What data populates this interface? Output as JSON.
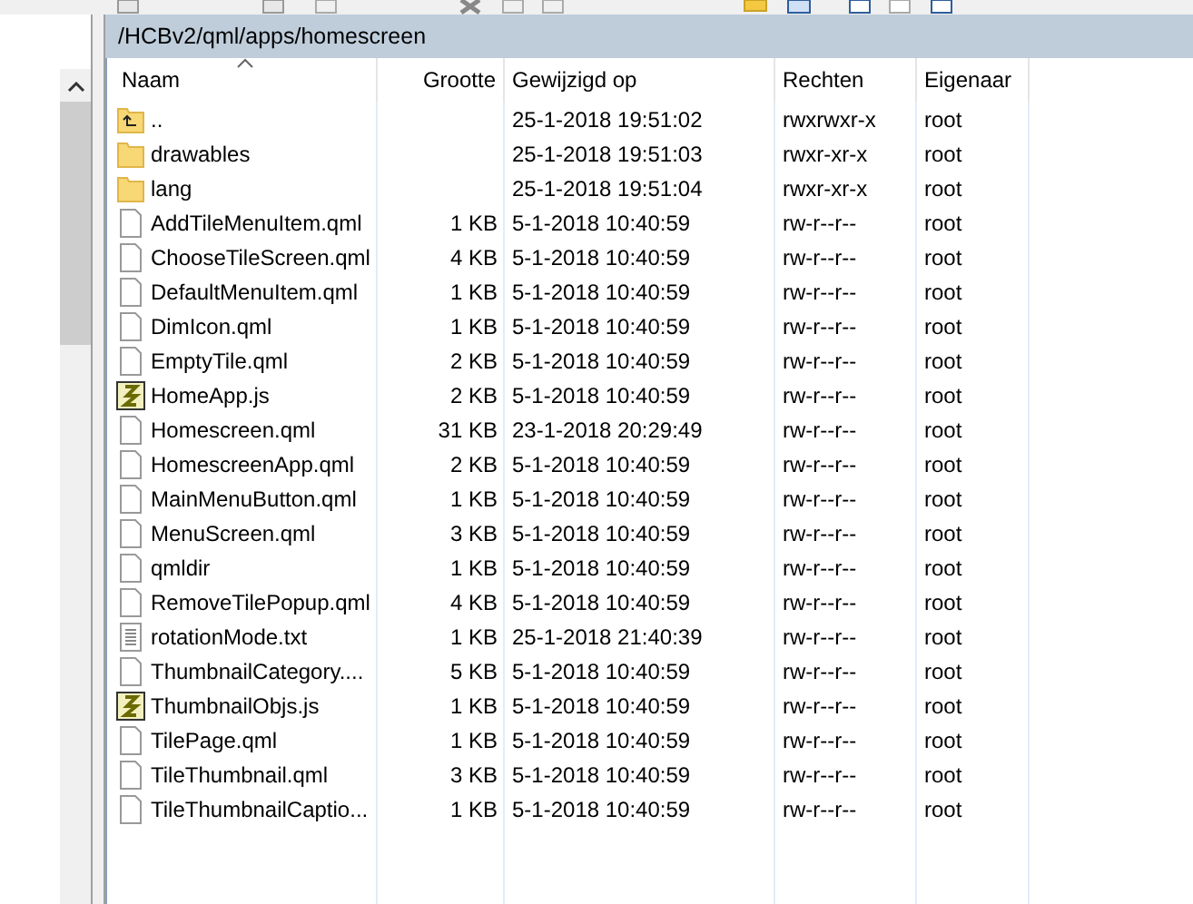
{
  "path_bar": {
    "path": "/HCBv2/qml/apps/homescreen"
  },
  "table": {
    "columns": [
      {
        "label": "Naam",
        "sorted": true
      },
      {
        "label": "Grootte",
        "sorted": false
      },
      {
        "label": "Gewijzigd op",
        "sorted": false
      },
      {
        "label": "Rechten",
        "sorted": false
      },
      {
        "label": "Eigenaar",
        "sorted": false
      }
    ],
    "rows": [
      {
        "kind": "parent",
        "name": "..",
        "size": "",
        "modified": "25-1-2018 19:51:02",
        "rights": "rwxrwxr-x",
        "owner": "root"
      },
      {
        "kind": "folder",
        "name": "drawables",
        "size": "",
        "modified": "25-1-2018 19:51:03",
        "rights": "rwxr-xr-x",
        "owner": "root"
      },
      {
        "kind": "folder",
        "name": "lang",
        "size": "",
        "modified": "25-1-2018 19:51:04",
        "rights": "rwxr-xr-x",
        "owner": "root"
      },
      {
        "kind": "file",
        "name": "AddTileMenuItem.qml",
        "size": "1 KB",
        "modified": "5-1-2018 10:40:59",
        "rights": "rw-r--r--",
        "owner": "root"
      },
      {
        "kind": "file",
        "name": "ChooseTileScreen.qml",
        "size": "4 KB",
        "modified": "5-1-2018 10:40:59",
        "rights": "rw-r--r--",
        "owner": "root"
      },
      {
        "kind": "file",
        "name": "DefaultMenuItem.qml",
        "size": "1 KB",
        "modified": "5-1-2018 10:40:59",
        "rights": "rw-r--r--",
        "owner": "root"
      },
      {
        "kind": "file",
        "name": "DimIcon.qml",
        "size": "1 KB",
        "modified": "5-1-2018 10:40:59",
        "rights": "rw-r--r--",
        "owner": "root"
      },
      {
        "kind": "file",
        "name": "EmptyTile.qml",
        "size": "2 KB",
        "modified": "5-1-2018 10:40:59",
        "rights": "rw-r--r--",
        "owner": "root"
      },
      {
        "kind": "script",
        "name": "HomeApp.js",
        "size": "2 KB",
        "modified": "5-1-2018 10:40:59",
        "rights": "rw-r--r--",
        "owner": "root"
      },
      {
        "kind": "file",
        "name": "Homescreen.qml",
        "size": "31 KB",
        "modified": "23-1-2018 20:29:49",
        "rights": "rw-r--r--",
        "owner": "root"
      },
      {
        "kind": "file",
        "name": "HomescreenApp.qml",
        "size": "2 KB",
        "modified": "5-1-2018 10:40:59",
        "rights": "rw-r--r--",
        "owner": "root"
      },
      {
        "kind": "file",
        "name": "MainMenuButton.qml",
        "size": "1 KB",
        "modified": "5-1-2018 10:40:59",
        "rights": "rw-r--r--",
        "owner": "root"
      },
      {
        "kind": "file",
        "name": "MenuScreen.qml",
        "size": "3 KB",
        "modified": "5-1-2018 10:40:59",
        "rights": "rw-r--r--",
        "owner": "root"
      },
      {
        "kind": "file",
        "name": "qmldir",
        "size": "1 KB",
        "modified": "5-1-2018 10:40:59",
        "rights": "rw-r--r--",
        "owner": "root"
      },
      {
        "kind": "file",
        "name": "RemoveTilePopup.qml",
        "size": "4 KB",
        "modified": "5-1-2018 10:40:59",
        "rights": "rw-r--r--",
        "owner": "root"
      },
      {
        "kind": "text",
        "name": "rotationMode.txt",
        "size": "1 KB",
        "modified": "25-1-2018 21:40:39",
        "rights": "rw-r--r--",
        "owner": "root"
      },
      {
        "kind": "file",
        "name": "ThumbnailCategory....",
        "size": "5 KB",
        "modified": "5-1-2018 10:40:59",
        "rights": "rw-r--r--",
        "owner": "root"
      },
      {
        "kind": "script",
        "name": "ThumbnailObjs.js",
        "size": "1 KB",
        "modified": "5-1-2018 10:40:59",
        "rights": "rw-r--r--",
        "owner": "root"
      },
      {
        "kind": "file",
        "name": "TilePage.qml",
        "size": "1 KB",
        "modified": "5-1-2018 10:40:59",
        "rights": "rw-r--r--",
        "owner": "root"
      },
      {
        "kind": "file",
        "name": "TileThumbnail.qml",
        "size": "3 KB",
        "modified": "5-1-2018 10:40:59",
        "rights": "rw-r--r--",
        "owner": "root"
      },
      {
        "kind": "file",
        "name": "TileThumbnailCaptio...",
        "size": "1 KB",
        "modified": "5-1-2018 10:40:59",
        "rights": "rw-r--r--",
        "owner": "root"
      }
    ]
  }
}
